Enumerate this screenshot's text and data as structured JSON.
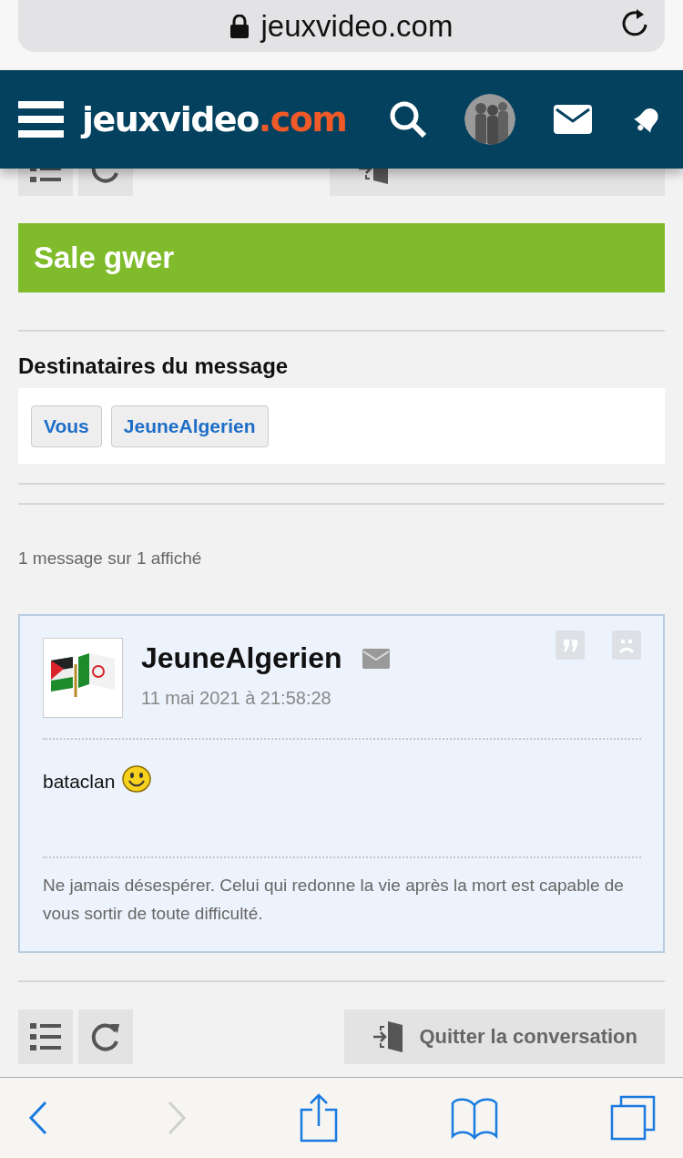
{
  "browser": {
    "url": "jeuxvideo.com"
  },
  "header": {
    "logo_main": "jeuxvideo",
    "logo_ext": ".com"
  },
  "topic": {
    "title": "Sale gwer"
  },
  "recipients": {
    "heading": "Destinataires du message",
    "names": [
      "Vous",
      "JeuneAlgerien"
    ]
  },
  "message_count": "1 message sur 1 affiché",
  "messages": [
    {
      "author": "JeuneAlgerien",
      "date": "11 mai 2021 à 21:58:28",
      "body": "bataclan",
      "signature": "Ne jamais désespérer. Celui qui redonne la vie après la mort est capable de vous sortir de toute difficulté."
    }
  ],
  "bottom_toolbar": {
    "quit_label": "Quitter la conversation"
  },
  "browser_nav": [
    {
      "kind": "back",
      "disabled": false
    },
    {
      "kind": "forward",
      "disabled": true
    },
    {
      "kind": "share",
      "disabled": false
    },
    {
      "kind": "bookmarks",
      "disabled": false
    },
    {
      "kind": "tabs",
      "disabled": false
    }
  ]
}
